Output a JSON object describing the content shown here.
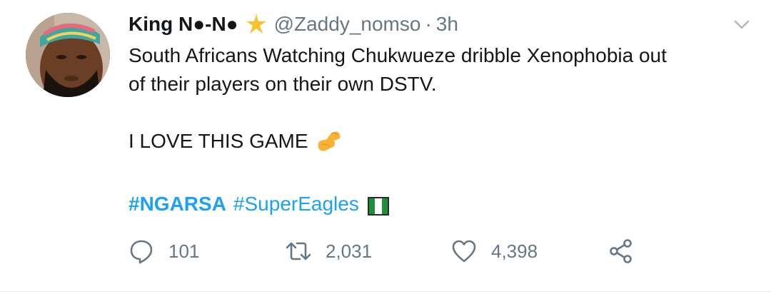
{
  "author": {
    "display_name": "King N●-N●",
    "badge_icon": "star-icon",
    "handle": "@Zaddy_nomso",
    "separator": "·",
    "time": "3h"
  },
  "tweet": {
    "lines": [
      "South Africans Watching Chukwueze dribble Xenophobia out",
      "of their players on their own DSTV.",
      "",
      "I LOVE THIS GAME"
    ],
    "emoji_icon": "flexed-biceps-icon",
    "hashtags": [
      "#NGARSA",
      "#SuperEagles"
    ],
    "flag_icon": "nigeria-flag-icon"
  },
  "actions": {
    "reply_count": "101",
    "retweet_count": "2,031",
    "like_count": "4,398"
  },
  "colors": {
    "text": "#14171a",
    "secondary": "#657786",
    "link": "#1da1f2",
    "divider": "#e6ecf0"
  }
}
